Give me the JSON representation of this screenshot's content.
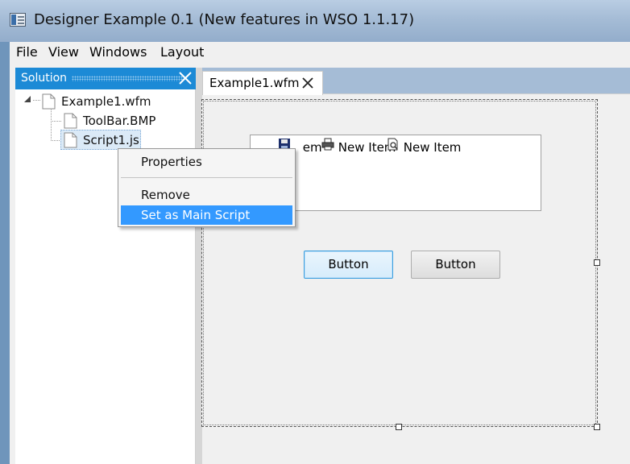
{
  "window": {
    "title": "Designer Example 0.1 (New features in WSO 1.1.17)",
    "icon": "app-window-icon"
  },
  "menubar": {
    "items": [
      "File",
      "View",
      "Windows",
      "Layout"
    ]
  },
  "solution_panel": {
    "title": "Solution",
    "close_icon": "close-icon",
    "tree": [
      {
        "label": "Example1.wfm",
        "icon": "file-icon",
        "expanded": true
      },
      {
        "label": "ToolBar.BMP",
        "icon": "file-icon"
      },
      {
        "label": "Script1.js",
        "icon": "file-icon",
        "selected": true
      }
    ]
  },
  "document_tab": {
    "label": "Example1.wfm",
    "close_icon": "close-icon"
  },
  "form": {
    "toolbar_items": [
      {
        "label": "New Item",
        "icon": "floppy-save-icon",
        "partial_text": "em"
      },
      {
        "label": "New Item",
        "icon": "printer-icon"
      },
      {
        "label": "New Item",
        "icon": "print-preview-icon"
      }
    ],
    "buttons": [
      "Button",
      "Button"
    ]
  },
  "context_menu": {
    "items": [
      "Properties",
      "Remove",
      "Set as Main Script"
    ],
    "highlighted": "Set as Main Script"
  },
  "colors": {
    "accent": "#1c8ad6",
    "highlight": "#3399ff",
    "titlebar": "#a5bcd6"
  }
}
